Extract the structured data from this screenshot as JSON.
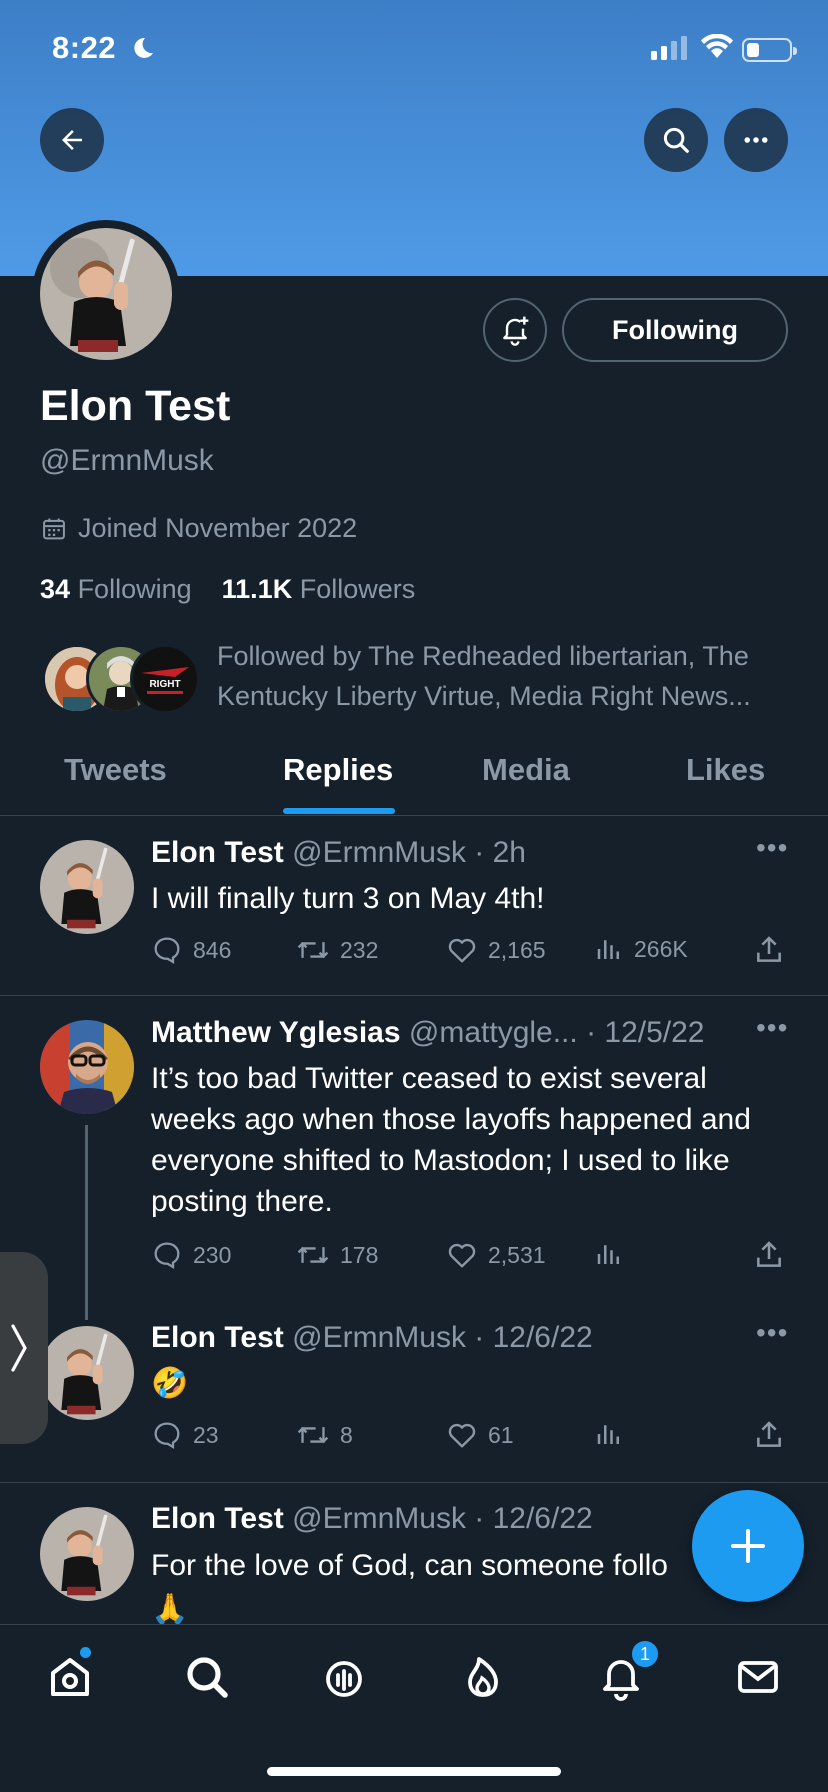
{
  "status_bar": {
    "time": "8:22"
  },
  "profile": {
    "name": "Elon Test",
    "handle": "@ErmnMusk",
    "joined": "Joined November 2022",
    "following_count": "34",
    "following_label": "Following",
    "followers_count": "11.1K",
    "followers_label": "Followers",
    "followed_by": "Followed by The Redheaded libertarian, The Kentucky Liberty Virtue, Media Right News...",
    "follow_button": "Following",
    "followed_by_logo_text": "RIGHT"
  },
  "tabs": [
    {
      "label": "Tweets"
    },
    {
      "label": "Replies"
    },
    {
      "label": "Media"
    },
    {
      "label": "Likes"
    }
  ],
  "tweets": [
    {
      "name": "Elon Test",
      "meta": "@ErmnMusk · 2h",
      "text": "I will finally turn 3 on May 4th!",
      "replies": "846",
      "retweets": "232",
      "likes": "2,165",
      "views": "266K"
    },
    {
      "name": "Matthew Yglesias",
      "meta": "@mattygle... · 12/5/22",
      "text": "It’s too bad Twitter ceased to exist several weeks ago when those layoffs happened and everyone shifted to Mastodon; I used to like posting there.",
      "replies": "230",
      "retweets": "178",
      "likes": "2,531",
      "views": ""
    },
    {
      "name": "Elon Test",
      "meta": "@ErmnMusk · 12/6/22",
      "text": "🤣",
      "replies": "23",
      "retweets": "8",
      "likes": "61",
      "views": ""
    },
    {
      "name": "Elon Test",
      "meta": "@ErmnMusk · 12/6/22",
      "text": "For the love of God, can someone follo",
      "replies": "",
      "retweets": "",
      "likes": "",
      "views": ""
    }
  ],
  "nav": {
    "notifications_badge": "1"
  },
  "colors": {
    "accent": "#1d9bf0",
    "background": "#15202b",
    "muted": "#8b98a5"
  }
}
